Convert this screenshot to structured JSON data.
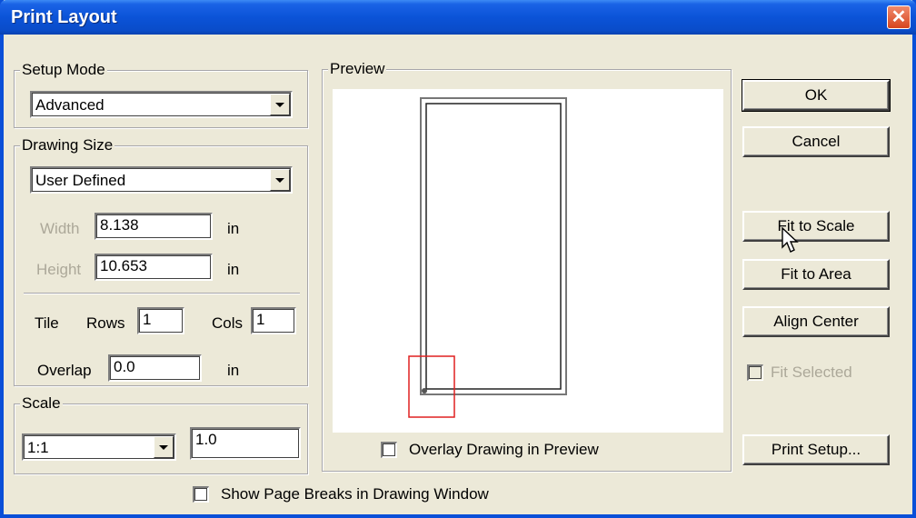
{
  "window": {
    "title": "Print Layout",
    "close_glyph": "✕"
  },
  "setup_mode": {
    "label": "Setup Mode",
    "value": "Advanced"
  },
  "drawing_size": {
    "label": "Drawing Size",
    "value": "User Defined",
    "width_label": "Width",
    "width_value": "8.138",
    "width_unit": "in",
    "height_label": "Height",
    "height_value": "10.653",
    "height_unit": "in"
  },
  "tile": {
    "label": "Tile",
    "rows_label": "Rows",
    "rows_value": "1",
    "cols_label": "Cols",
    "cols_value": "1",
    "overlap_label": "Overlap",
    "overlap_value": "0.0",
    "overlap_unit": "in"
  },
  "scale": {
    "label": "Scale",
    "value": "1:1",
    "factor": "1.0"
  },
  "preview": {
    "label": "Preview",
    "overlay_label": "Overlay Drawing in Preview"
  },
  "buttons": {
    "ok": "OK",
    "cancel": "Cancel",
    "fit_to_scale": "Fit to Scale",
    "fit_to_area": "Fit to Area",
    "align_center": "Align Center",
    "fit_selected": "Fit Selected",
    "print_setup": "Print Setup..."
  },
  "show_page_breaks_label": "Show Page Breaks in Drawing Window",
  "colors": {
    "titlebar": "#0b53d8",
    "face": "#ece9d8",
    "highlight_box": "#e02020"
  }
}
